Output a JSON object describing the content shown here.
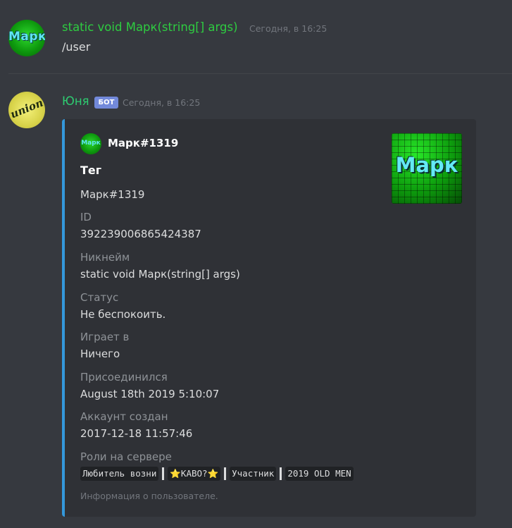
{
  "messages": [
    {
      "author": "static void Марк(string[] args)",
      "author_color": "#2ecc40",
      "timestamp": "Сегодня, в 16:25",
      "content": "/user",
      "avatar_text": "Марк"
    },
    {
      "author": "Юня",
      "author_color": "#2ecc71",
      "badge": "БОТ",
      "timestamp": "Сегодня, в 16:25",
      "avatar_text": "union"
    }
  ],
  "embed": {
    "accent_color": "#3498db",
    "author_name": "Марк#1319",
    "author_icon_text": "Марк",
    "title": "Тег",
    "description": "Марк#1319",
    "thumbnail_text": "Марк",
    "fields": [
      {
        "name": "ID",
        "value": "392239006865424387"
      },
      {
        "name": "Никнейм",
        "value": "static void Марк(string[] args)"
      },
      {
        "name": "Статус",
        "value": "Не беспокоить."
      },
      {
        "name": "Играет в",
        "value": "Ничего"
      },
      {
        "name": "Присоединился",
        "value": "August 18th 2019 5:10:07"
      },
      {
        "name": "Аккаунт создан",
        "value": "2017-12-18 11:57:46"
      },
      {
        "name": "Роли на сервере",
        "value": ""
      }
    ],
    "roles": [
      "Любитель возни",
      "⭐КАВО?⭐",
      "Участник",
      "2019 OLD MEN"
    ],
    "footer": "Информация о пользователе."
  }
}
